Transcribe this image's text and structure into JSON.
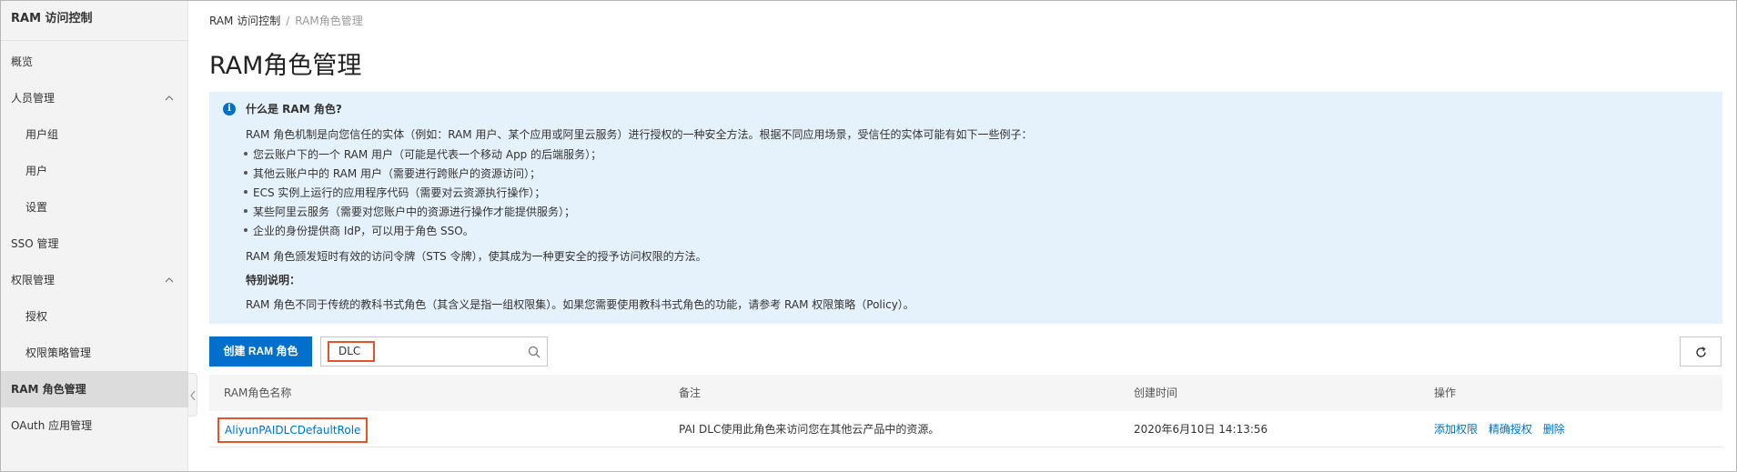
{
  "sidebar": {
    "title": "RAM 访问控制",
    "items": [
      {
        "label": "概览"
      },
      {
        "label": "人员管理"
      },
      {
        "label": "用户组"
      },
      {
        "label": "用户"
      },
      {
        "label": "设置"
      },
      {
        "label": "SSO 管理"
      },
      {
        "label": "权限管理"
      },
      {
        "label": "授权"
      },
      {
        "label": "权限策略管理"
      },
      {
        "label": "RAM 角色管理"
      },
      {
        "label": "OAuth 应用管理"
      }
    ]
  },
  "breadcrumb": {
    "root": "RAM 访问控制",
    "separator": "/",
    "current": "RAM角色管理"
  },
  "page_title": "RAM角色管理",
  "info": {
    "icon": "i",
    "heading": "什么是 RAM 角色?",
    "intro": "RAM 角色机制是向您信任的实体（例如：RAM 用户、某个应用或阿里云服务）进行授权的一种安全方法。根据不同应用场景，受信任的实体可能有如下一些例子：",
    "bullets": [
      "您云账户下的一个 RAM 用户（可能是代表一个移动 App 的后端服务）；",
      "其他云账户中的 RAM 用户（需要进行跨账户的资源访问）；",
      "ECS 实例上运行的应用程序代码（需要对云资源执行操作）；",
      "某些阿里云服务（需要对您账户中的资源进行操作才能提供服务）；",
      "企业的身份提供商 IdP，可以用于角色 SSO。"
    ],
    "sts_note": "RAM 角色颁发短时有效的访问令牌（STS 令牌），使其成为一种更安全的授予访问权限的方法。",
    "special_heading": "特别说明：",
    "special_note": "RAM 角色不同于传统的教科书式角色（其含义是指一组权限集）。如果您需要使用教科书式角色的功能，请参考 RAM 权限策略（Policy）。"
  },
  "toolbar": {
    "create_label": "创建 RAM 角色",
    "search_value": "DLC"
  },
  "table": {
    "columns": [
      "RAM角色名称",
      "备注",
      "创建时间",
      "操作"
    ],
    "rows": [
      {
        "name": "AliyunPAIDLCDefaultRole",
        "note": "PAI DLC使用此角色来访问您在其他云产品中的资源。",
        "created": "2020年6月10日 14:13:56",
        "actions": [
          "添加权限",
          "精确授权",
          "删除"
        ]
      }
    ]
  },
  "colors": {
    "accent": "#0070cc",
    "highlight": "#e4532a",
    "info_bg": "#e6f2fb"
  }
}
